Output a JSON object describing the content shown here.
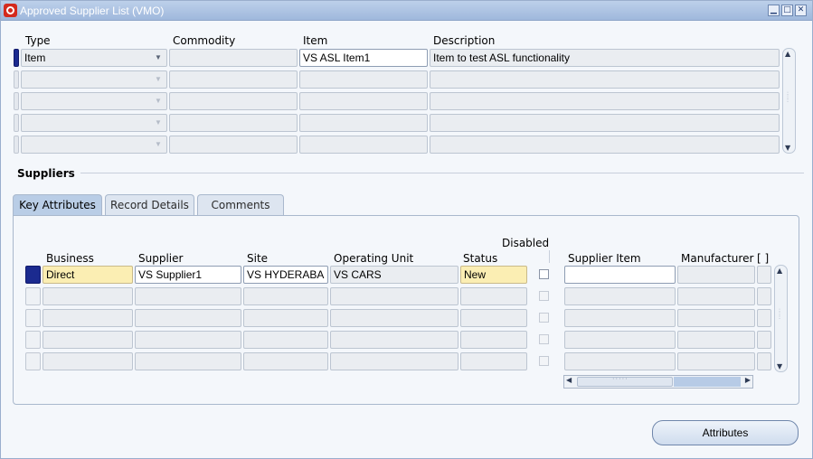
{
  "window": {
    "title": "Approved Supplier List (VMO)",
    "controls": {
      "minimize": "▁",
      "maximize": "□",
      "close": "✕"
    }
  },
  "asl": {
    "headers": {
      "type": "Type",
      "commodity": "Commodity",
      "item": "Item",
      "description": "Description"
    },
    "rows": [
      {
        "type": "Item",
        "commodity": "",
        "item": "VS ASL Item1",
        "description": "Item to test ASL functionality"
      },
      {
        "type": "",
        "commodity": "",
        "item": "",
        "description": ""
      },
      {
        "type": "",
        "commodity": "",
        "item": "",
        "description": ""
      },
      {
        "type": "",
        "commodity": "",
        "item": "",
        "description": ""
      },
      {
        "type": "",
        "commodity": "",
        "item": "",
        "description": ""
      }
    ]
  },
  "suppliers": {
    "section_title": "Suppliers",
    "tabs": [
      {
        "label": "Key Attributes",
        "selected": true
      },
      {
        "label": "Record Details",
        "selected": false
      },
      {
        "label": "Comments",
        "selected": false
      }
    ],
    "headers": {
      "business": "Business",
      "supplier": "Supplier",
      "site": "Site",
      "operating_unit": "Operating Unit",
      "status": "Status",
      "disabled": "Disabled",
      "supplier_item": "Supplier Item",
      "manufacturer": "Manufacturer",
      "more": "[ ]"
    },
    "rows": [
      {
        "business": "Direct",
        "supplier": "VS Supplier1",
        "site": "VS HYDERABA",
        "operating_unit": "VS CARS",
        "status": "New",
        "disabled": false,
        "supplier_item": "",
        "manufacturer": ""
      },
      {
        "business": "",
        "supplier": "",
        "site": "",
        "operating_unit": "",
        "status": "",
        "disabled": false,
        "supplier_item": "",
        "manufacturer": ""
      },
      {
        "business": "",
        "supplier": "",
        "site": "",
        "operating_unit": "",
        "status": "",
        "disabled": false,
        "supplier_item": "",
        "manufacturer": ""
      },
      {
        "business": "",
        "supplier": "",
        "site": "",
        "operating_unit": "",
        "status": "",
        "disabled": false,
        "supplier_item": "",
        "manufacturer": ""
      },
      {
        "business": "",
        "supplier": "",
        "site": "",
        "operating_unit": "",
        "status": "",
        "disabled": false,
        "supplier_item": "",
        "manufacturer": ""
      }
    ]
  },
  "buttons": {
    "attributes": "Attributes"
  },
  "colors": {
    "required_field": "#fbeeb3",
    "current_record": "#1b2a8f",
    "title_bar": "#9fb8dc"
  }
}
